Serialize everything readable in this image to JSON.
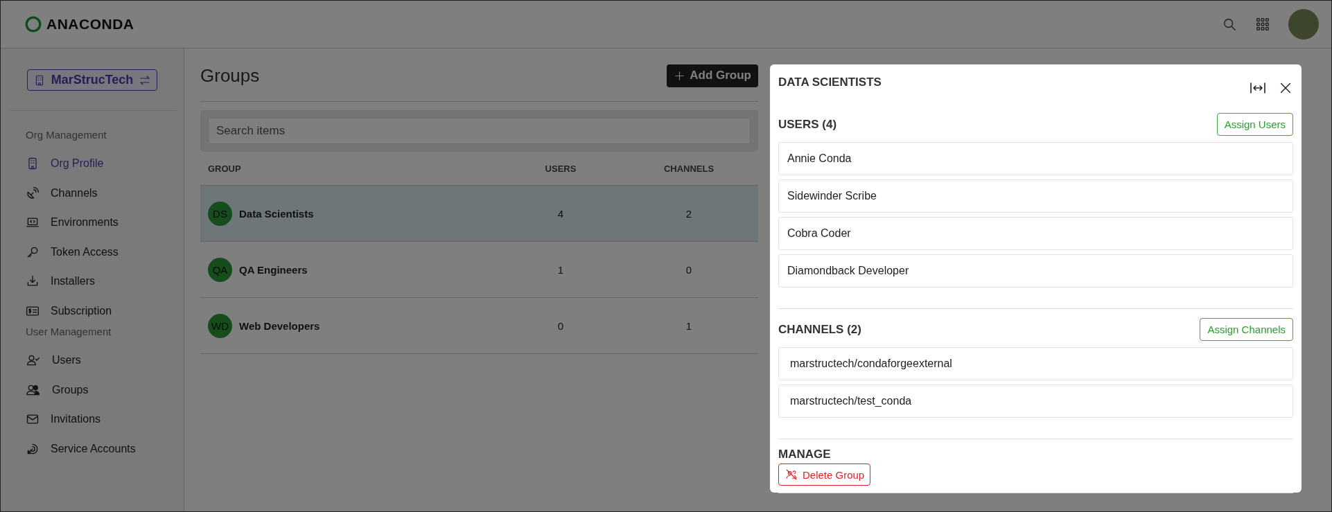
{
  "header": {
    "logo": "ANACONDA"
  },
  "sidebar": {
    "org_switcher": {
      "label": "MarStrucTech"
    },
    "sections": [
      {
        "title": "Org Management",
        "items": [
          {
            "label": "Org Profile",
            "selected": true
          },
          {
            "label": "Channels",
            "selected": false
          },
          {
            "label": "Environments",
            "selected": false
          },
          {
            "label": "Token Access",
            "selected": false
          },
          {
            "label": "Installers",
            "selected": false
          },
          {
            "label": "Subscription",
            "selected": false
          }
        ]
      },
      {
        "title": "User Management",
        "items": [
          {
            "label": "Users",
            "selected": false
          },
          {
            "label": "Groups",
            "selected": false
          },
          {
            "label": "Invitations",
            "selected": false
          },
          {
            "label": "Service Accounts",
            "selected": false
          }
        ]
      }
    ]
  },
  "groups_page": {
    "title": "Groups",
    "add_button": "Add Group",
    "search": {
      "placeholder": "Search items"
    },
    "table": {
      "columns": [
        "GROUP",
        "USERS",
        "CHANNELS"
      ],
      "rows": [
        {
          "initials": "DS",
          "name": "Data Scientists",
          "users": "4",
          "channels": "2",
          "selected": true
        },
        {
          "initials": "QA",
          "name": "QA Engineers",
          "users": "1",
          "channels": "0",
          "selected": false
        },
        {
          "initials": "WD",
          "name": "Web Developers",
          "users": "0",
          "channels": "1",
          "selected": false
        }
      ]
    }
  },
  "detail_panel": {
    "title": "DATA SCIENTISTS",
    "users": {
      "heading": "USERS (4)",
      "button": "Assign Users",
      "items": [
        "Annie Conda",
        "Sidewinder Scribe",
        "Cobra Coder",
        "Diamondback Developer"
      ]
    },
    "channels": {
      "heading": "CHANNELS (2)",
      "button": "Assign Channels",
      "items": [
        "marstructech/condaforgeexternal",
        "marstructech/test_conda"
      ]
    },
    "manage": {
      "heading": "MANAGE",
      "delete_button": "Delete Group"
    }
  }
}
